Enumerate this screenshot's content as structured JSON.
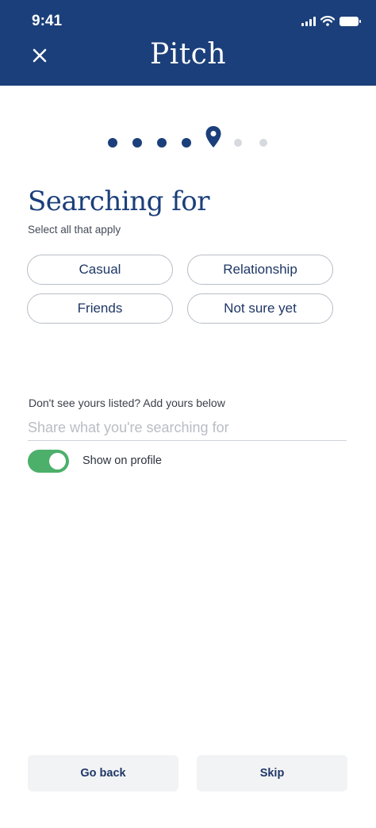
{
  "status_bar": {
    "time": "9:41"
  },
  "header": {
    "logo": "Pitch"
  },
  "progress": {
    "total_steps": 7,
    "current_step": 5
  },
  "page": {
    "title": "Searching for",
    "subtitle": "Select all that apply"
  },
  "options": [
    {
      "label": "Casual"
    },
    {
      "label": "Relationship"
    },
    {
      "label": "Friends"
    },
    {
      "label": "Not sure yet"
    }
  ],
  "custom": {
    "hint": "Don't see yours listed? Add yours below",
    "placeholder": "Share what you're searching for",
    "value": ""
  },
  "toggle": {
    "label": "Show on profile",
    "on": true,
    "color": "#4caf6a"
  },
  "footer": {
    "back_label": "Go back",
    "skip_label": "Skip"
  },
  "colors": {
    "brand": "#1b3f7a",
    "toggle_on": "#4caf6a"
  }
}
